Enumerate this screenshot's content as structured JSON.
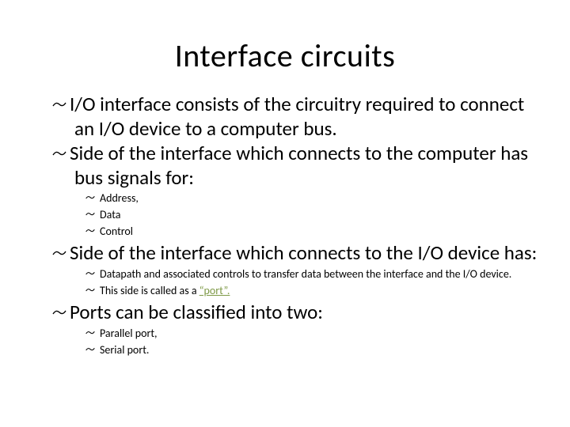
{
  "title": "Interface circuits",
  "bullets": {
    "b1": "I/O interface consists of the circuitry required to connect an I/O device to a computer bus.",
    "b2": "Side of the interface which connects to the computer has bus signals for:",
    "b2_sub": {
      "s1": "Address,",
      "s2": "Data",
      "s3": "Control"
    },
    "b3": "Side of the interface which connects to the I/O device has:",
    "b3_sub": {
      "s1": "Datapath and associated controls to transfer data between the interface and the I/O device.",
      "s2_pre": "This side is called as a ",
      "s2_port": "“port”.",
      "s2_post": ""
    },
    "b4": "Ports can be classified into two:",
    "b4_sub": {
      "s1": "Parallel port,",
      "s2": "Serial port."
    }
  }
}
